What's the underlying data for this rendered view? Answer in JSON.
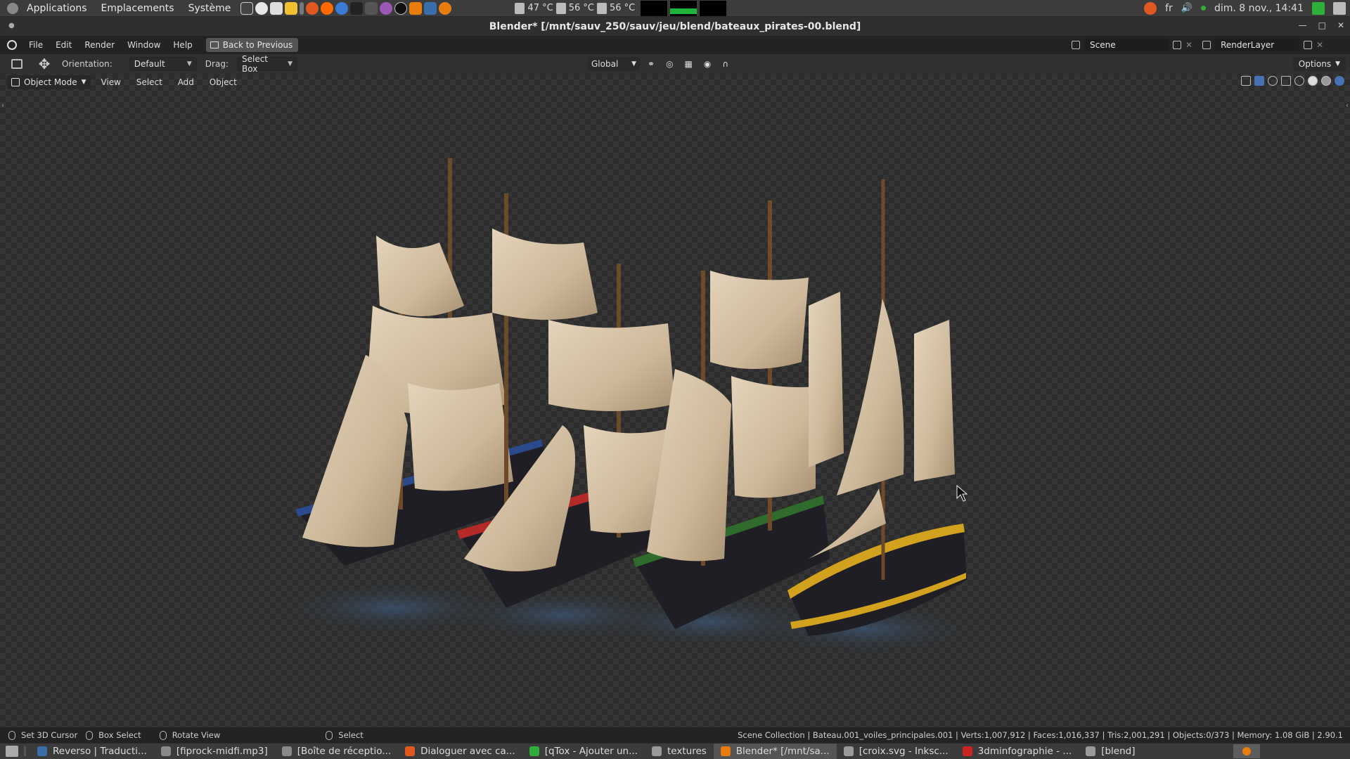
{
  "system_panel": {
    "menu": [
      "Applications",
      "Emplacements",
      "Système"
    ],
    "temps": [
      "47 °C",
      "56 °C",
      "56 °C"
    ],
    "keyboard_layout": "fr",
    "clock": "dim.  8 nov., 14:41"
  },
  "title_bar": {
    "title": "Blender* [/mnt/sauv_250/sauv/jeu/blend/bateaux_pirates-00.blend]"
  },
  "topbar": {
    "menu": [
      "File",
      "Edit",
      "Render",
      "Window",
      "Help"
    ],
    "back_button": "Back to Previous",
    "scene": "Scene",
    "render_layer": "RenderLayer"
  },
  "tool_header": {
    "orientation_label": "Orientation:",
    "orientation_value": "Default",
    "drag_label": "Drag:",
    "drag_value": "Select Box",
    "transform_orientation": "Global",
    "options": "Options"
  },
  "viewport_header": {
    "mode": "Object Mode",
    "menu": [
      "View",
      "Select",
      "Add",
      "Object"
    ]
  },
  "status_bar": {
    "hints": [
      "Set 3D Cursor",
      "Box Select",
      "Rotate View",
      "Select"
    ],
    "stats": "Scene Collection | Bateau.001_voiles_principales.001 | Verts:1,007,912 | Faces:1,016,337 | Tris:2,001,291 | Objects:0/373 | Memory: 1.08 GiB | 2.90.1"
  },
  "taskbar": {
    "tasks": [
      {
        "label": "Reverso | Traducti...",
        "color": "#3a6ea8"
      },
      {
        "label": "[fiprock-midfi.mp3]",
        "color": "#8a8a8a"
      },
      {
        "label": "[Boîte de réceptio...",
        "color": "#8a8a8a"
      },
      {
        "label": "Dialoguer avec ca...",
        "color": "#e05a1f"
      },
      {
        "label": "[qTox - Ajouter un...",
        "color": "#2fae39"
      },
      {
        "label": "textures",
        "color": "#9a9a9a"
      },
      {
        "label": "Blender* [/mnt/sa...",
        "color": "#e87d0d"
      },
      {
        "label": "[croix.svg - Inksc...",
        "color": "#9a9a9a"
      },
      {
        "label": "3dminfographie - ...",
        "color": "#cc2222"
      },
      {
        "label": "[blend]",
        "color": "#9a9a9a"
      }
    ]
  },
  "colors": {
    "accent": "#4772b3",
    "blender_orange": "#e87d0d",
    "hull_blue": "#2b4a8c",
    "hull_red": "#b42a26",
    "hull_green": "#2f6b2c",
    "hull_yellow": "#d2a11e",
    "sail": "#d8c6ad"
  }
}
